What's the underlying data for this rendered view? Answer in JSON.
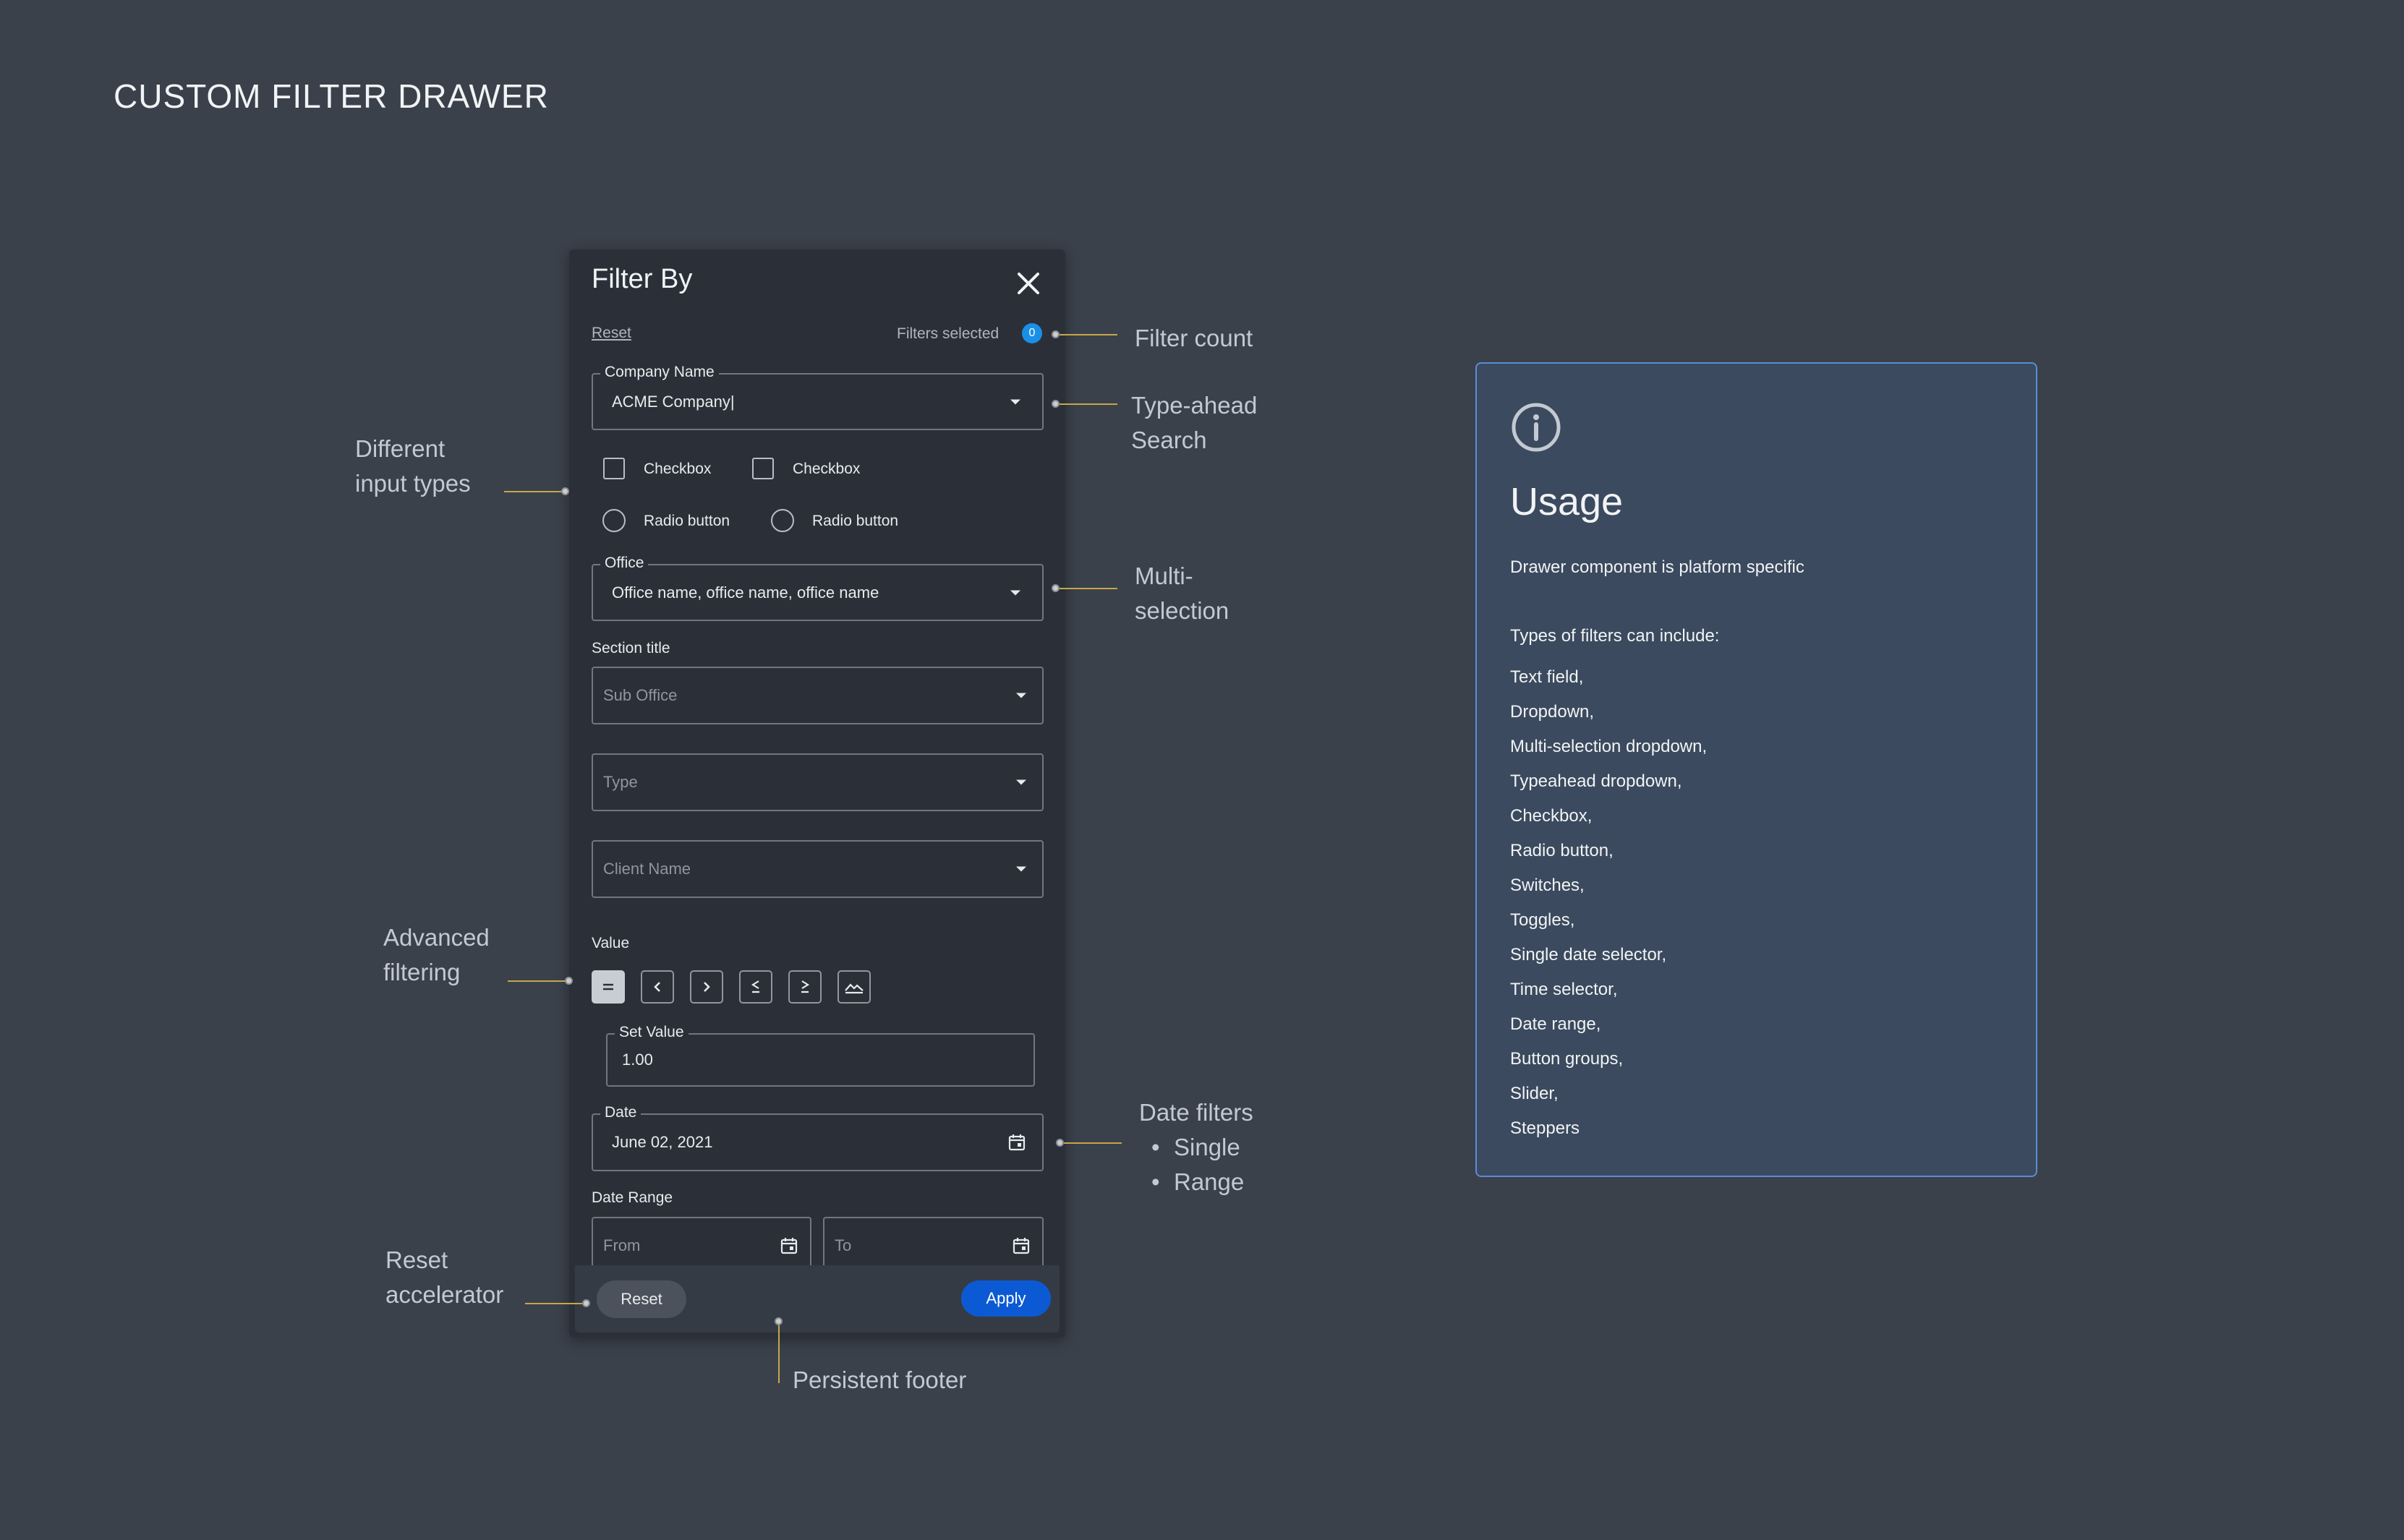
{
  "page_title": "CUSTOM FILTER DRAWER",
  "drawer": {
    "title": "Filter By",
    "reset_link": "Reset",
    "filters_selected_label": "Filters selected",
    "filters_count": "0",
    "company_field": {
      "label": "Company Name",
      "value": "ACME Company|"
    },
    "checkboxes": [
      "Checkbox",
      "Checkbox"
    ],
    "radios": [
      "Radio button",
      "Radio button"
    ],
    "office_field": {
      "label": "Office",
      "value": "Office name, office name, office name"
    },
    "section_title": "Section title",
    "dropdowns": [
      {
        "placeholder": "Sub Office"
      },
      {
        "placeholder": "Type"
      },
      {
        "placeholder": "Client Name"
      }
    ],
    "value_label": "Value",
    "operators": [
      "equals",
      "less-than",
      "greater-than",
      "less-or-equal",
      "greater-or-equal",
      "range"
    ],
    "selected_operator": "equals",
    "set_value_field": {
      "label": "Set Value",
      "value": "1.00"
    },
    "date_field": {
      "label": "Date",
      "value": "June 02, 2021"
    },
    "date_range_label": "Date Range",
    "date_range_from": "From",
    "date_range_to": "To",
    "footer": {
      "reset": "Reset",
      "apply": "Apply"
    }
  },
  "annotations": {
    "filter_count": "Filter count",
    "typeahead_1": "Type-ahead",
    "typeahead_2": "Search",
    "different_1": "Different",
    "different_2": "input types",
    "multi_1": "Multi-",
    "multi_2": "selection",
    "advanced_1": "Advanced",
    "advanced_2": "filtering",
    "date_filters": "Date filters",
    "date_single": "Single",
    "date_range": "Range",
    "reset_acc_1": "Reset",
    "reset_acc_2": "accelerator",
    "persistent_footer": "Persistent footer"
  },
  "usage": {
    "title": "Usage",
    "description": "Drawer component is platform specific",
    "intro": "Types of filters can include:",
    "items": [
      "Text field,",
      "Dropdown,",
      "Multi-selection dropdown,",
      "Typeahead dropdown,",
      "Checkbox,",
      "Radio button,",
      "Switches,",
      "Toggles,",
      "Single date selector,",
      "Time selector,",
      "Date range,",
      "Button groups,",
      "Slider,",
      "Steppers"
    ]
  },
  "colors": {
    "background": "#3a414b",
    "drawer": "#2b3038",
    "accent": "#0b5ad4",
    "badge": "#1a8fe8",
    "connector": "#c8a64a",
    "usage_card": "#3b4a5e"
  }
}
